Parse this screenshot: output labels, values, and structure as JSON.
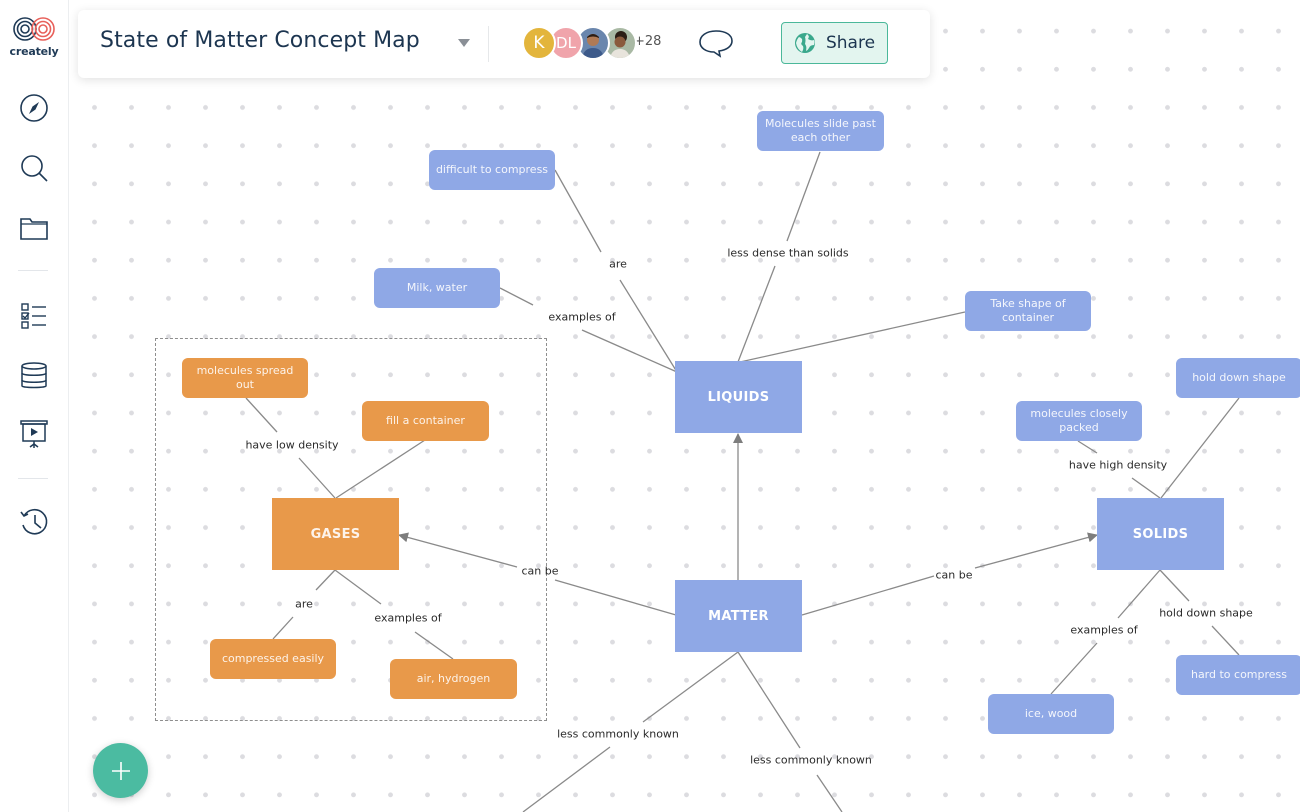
{
  "app": {
    "logo_text": "creately",
    "title": "State of Matter Concept Map"
  },
  "sidebar": {
    "items": [
      {
        "name": "compass-icon",
        "label": "Explore"
      },
      {
        "name": "search-icon",
        "label": "Search"
      },
      {
        "name": "folder-icon",
        "label": "Folder"
      },
      {
        "name": "checklist-icon",
        "label": "Tasks"
      },
      {
        "name": "database-icon",
        "label": "Data"
      },
      {
        "name": "presentation-icon",
        "label": "Present"
      },
      {
        "name": "history-icon",
        "label": "History"
      }
    ]
  },
  "topbar": {
    "collaborators": [
      {
        "initial": "K",
        "color": "#e3b53c"
      },
      {
        "initial": "DL",
        "color": "#f0a4ab"
      },
      {
        "initial": "",
        "color": "#6a86ad"
      },
      {
        "initial": "",
        "color": "#a9b9a4"
      }
    ],
    "more_collaborators": "+28",
    "share_label": "Share",
    "share_color": "#4bb89a"
  },
  "colors": {
    "liquid_solid_nodes": "#8fa8e6",
    "gas_nodes": "#e8994a",
    "fab": "#4bbba1"
  },
  "diagram": {
    "nodes": {
      "matter": "MATTER",
      "liquids": "LIQUIDS",
      "gases": "GASES",
      "solids": "SOLIDS",
      "difficult_to_compress": "difficult to compress",
      "molecules_slide": "Molecules slide past each other",
      "milk_water": "Milk, water",
      "take_shape": "Take shape of container",
      "molecules_spread": "molecules spread out",
      "fill_container": "fill a container",
      "compressed_easily": "compressed easily",
      "air_hydrogen": "air, hydrogen",
      "hold_down_shape_top": "hold down shape",
      "molecules_closely": "molecules closely packed",
      "hard_to_compress": "hard to compress",
      "ice_wood": "ice, wood"
    },
    "labels": {
      "are_liquids": "are",
      "less_dense": "less dense than solids",
      "examples_liquids": "examples of",
      "have_low_density": "have low density",
      "can_be_gases": "can be",
      "are_gases": "are",
      "examples_gases": "examples of",
      "can_be_solids": "can be",
      "have_high_density": "have high density",
      "examples_solids": "examples of",
      "hold_down_shape_label": "hold down shape",
      "less_common_left": "less commonly known",
      "less_common_right": "less commonly known"
    }
  }
}
